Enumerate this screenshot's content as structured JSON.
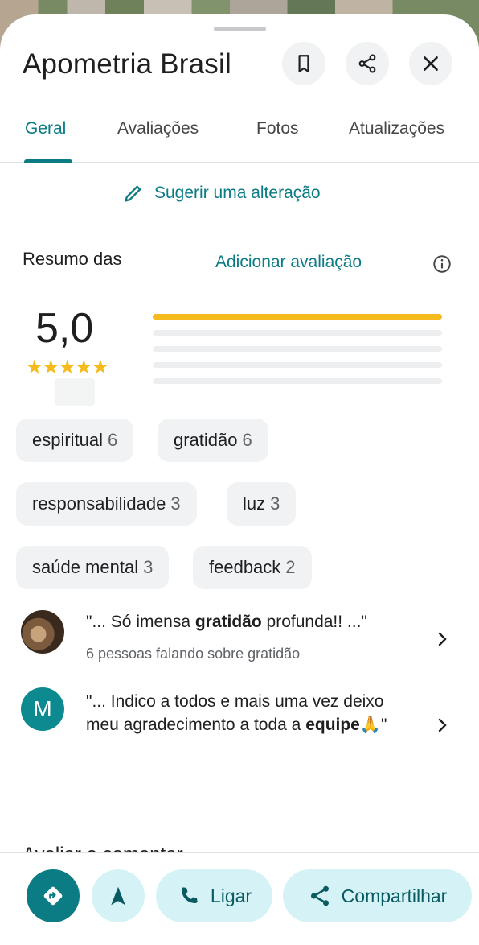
{
  "place": {
    "title": "Apometria Brasil"
  },
  "header_buttons": {
    "save_icon": "bookmark-icon",
    "share_icon": "share-icon",
    "close_icon": "close-icon"
  },
  "tabs": [
    {
      "label": "Geral",
      "active": true
    },
    {
      "label": "Avaliações",
      "active": false
    },
    {
      "label": "Fotos",
      "active": false
    },
    {
      "label": "Atualizações",
      "active": false
    }
  ],
  "suggest_edit": {
    "label": "Sugerir uma alteração"
  },
  "reviews_summary": {
    "title": "Resumo das",
    "add_review_label": "Adicionar avaliação",
    "rating": "5,0",
    "stars": "★★★★★",
    "distribution": [
      {
        "stars": 5,
        "fraction": 1.0
      },
      {
        "stars": 4,
        "fraction": 0.0
      },
      {
        "stars": 3,
        "fraction": 0.0
      },
      {
        "stars": 2,
        "fraction": 0.0
      },
      {
        "stars": 1,
        "fraction": 0.0
      }
    ]
  },
  "topics": [
    {
      "label": "espiritual",
      "count": "6"
    },
    {
      "label": "gratidão",
      "count": "6"
    },
    {
      "label": "responsabilidade",
      "count": "3"
    },
    {
      "label": "luz",
      "count": "3"
    },
    {
      "label": "saúde mental",
      "count": "3"
    },
    {
      "label": "feedback",
      "count": "2"
    }
  ],
  "review_snippets": [
    {
      "text_before": "\"... Só imensa ",
      "highlight": "gratidão",
      "text_after": " profunda!! ...\"",
      "subtitle": "6 pessoas falando sobre gratidão"
    },
    {
      "avatar_letter": "M",
      "text_before": "\"... Indico a todos e mais uma vez deixo meu agradecimento a toda a ",
      "highlight": "equipe",
      "text_after": "🙏\""
    }
  ],
  "rate_section": {
    "title": "Avaliar e comentar"
  },
  "actions": {
    "directions_icon": "directions-icon",
    "navigate_icon": "navigation-arrow-icon",
    "call_label": "Ligar",
    "share_label": "Compartilhar"
  },
  "colors": {
    "accent": "#0b7b84",
    "star": "#f5bb1c",
    "chip_bg": "#f0f2f3",
    "action_bg": "#d5f3f6"
  }
}
